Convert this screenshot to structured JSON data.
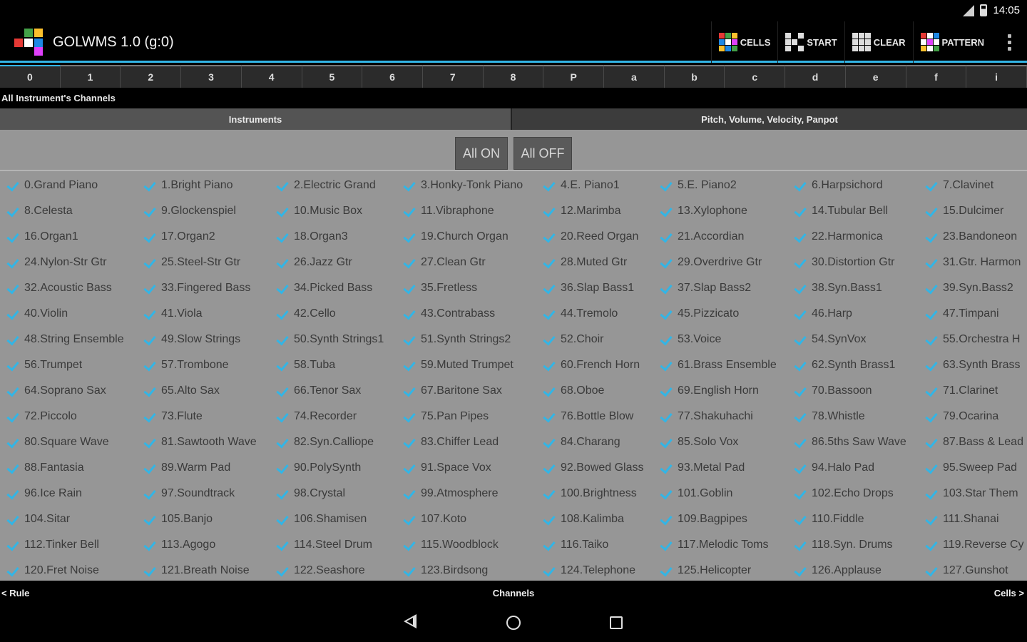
{
  "status": {
    "time": "14:05"
  },
  "app": {
    "title": "GOLWMS 1.0 (g:0)"
  },
  "actions": [
    {
      "label": "CELLS"
    },
    {
      "label": "START"
    },
    {
      "label": "CLEAR"
    },
    {
      "label": "PATTERN"
    }
  ],
  "channels": [
    "0",
    "1",
    "2",
    "3",
    "4",
    "5",
    "6",
    "7",
    "8",
    "P",
    "a",
    "b",
    "c",
    "d",
    "e",
    "f",
    "i"
  ],
  "section_label": "All Instrument's Channels",
  "subtabs": {
    "instruments": "Instruments",
    "pitch": "Pitch, Volume, Velocity, Panpot"
  },
  "buttons": {
    "all_on": "All ON",
    "all_off": "All OFF"
  },
  "instruments": [
    "0.Grand Piano",
    "1.Bright Piano",
    "2.Electric Grand",
    "3.Honky-Tonk Piano",
    "4.E. Piano1",
    "5.E. Piano2",
    "6.Harpsichord",
    "7.Clavinet",
    "8.Celesta",
    "9.Glockenspiel",
    "10.Music Box",
    "11.Vibraphone",
    "12.Marimba",
    "13.Xylophone",
    "14.Tubular Bell",
    "15.Dulcimer",
    "16.Organ1",
    "17.Organ2",
    "18.Organ3",
    "19.Church Organ",
    "20.Reed Organ",
    "21.Accordian",
    "22.Harmonica",
    "23.Bandoneon",
    "24.Nylon-Str Gtr",
    "25.Steel-Str Gtr",
    "26.Jazz Gtr",
    "27.Clean Gtr",
    "28.Muted Gtr",
    "29.Overdrive Gtr",
    "30.Distortion Gtr",
    "31.Gtr. Harmon",
    "32.Acoustic Bass",
    "33.Fingered Bass",
    "34.Picked Bass",
    "35.Fretless",
    "36.Slap Bass1",
    "37.Slap Bass2",
    "38.Syn.Bass1",
    "39.Syn.Bass2",
    "40.Violin",
    "41.Viola",
    "42.Cello",
    "43.Contrabass",
    "44.Tremolo",
    "45.Pizzicato",
    "46.Harp",
    "47.Timpani",
    "48.String Ensemble",
    "49.Slow Strings",
    "50.Synth Strings1",
    "51.Synth Strings2",
    "52.Choir",
    "53.Voice",
    "54.SynVox",
    "55.Orchestra H",
    "56.Trumpet",
    "57.Trombone",
    "58.Tuba",
    "59.Muted Trumpet",
    "60.French Horn",
    "61.Brass Ensemble",
    "62.Synth Brass1",
    "63.Synth Brass",
    "64.Soprano Sax",
    "65.Alto Sax",
    "66.Tenor Sax",
    "67.Baritone Sax",
    "68.Oboe",
    "69.English Horn",
    "70.Bassoon",
    "71.Clarinet",
    "72.Piccolo",
    "73.Flute",
    "74.Recorder",
    "75.Pan Pipes",
    "76.Bottle Blow",
    "77.Shakuhachi",
    "78.Whistle",
    "79.Ocarina",
    "80.Square Wave",
    "81.Sawtooth Wave",
    "82.Syn.Calliope",
    "83.Chiffer Lead",
    "84.Charang",
    "85.Solo Vox",
    "86.5ths Saw Wave",
    "87.Bass & Lead",
    "88.Fantasia",
    "89.Warm Pad",
    "90.PolySynth",
    "91.Space Vox",
    "92.Bowed Glass",
    "93.Metal Pad",
    "94.Halo Pad",
    "95.Sweep Pad",
    "96.Ice Rain",
    "97.Soundtrack",
    "98.Crystal",
    "99.Atmosphere",
    "100.Brightness",
    "101.Goblin",
    "102.Echo Drops",
    "103.Star Them",
    "104.Sitar",
    "105.Banjo",
    "106.Shamisen",
    "107.Koto",
    "108.Kalimba",
    "109.Bagpipes",
    "110.Fiddle",
    "111.Shanai",
    "112.Tinker Bell",
    "113.Agogo",
    "114.Steel Drum",
    "115.Woodblock",
    "116.Taiko",
    "117.Melodic Toms",
    "118.Syn. Drums",
    "119.Reverse Cy",
    "120.Fret Noise",
    "121.Breath Noise",
    "122.Seashore",
    "123.Birdsong",
    "124.Telephone",
    "125.Helicopter",
    "126.Applause",
    "127.Gunshot"
  ],
  "bottom_nav": {
    "left": "< Rule",
    "center": "Channels",
    "right": "Cells >"
  },
  "colors": {
    "accent": "#33b5e5",
    "content_bg": "#969696"
  }
}
